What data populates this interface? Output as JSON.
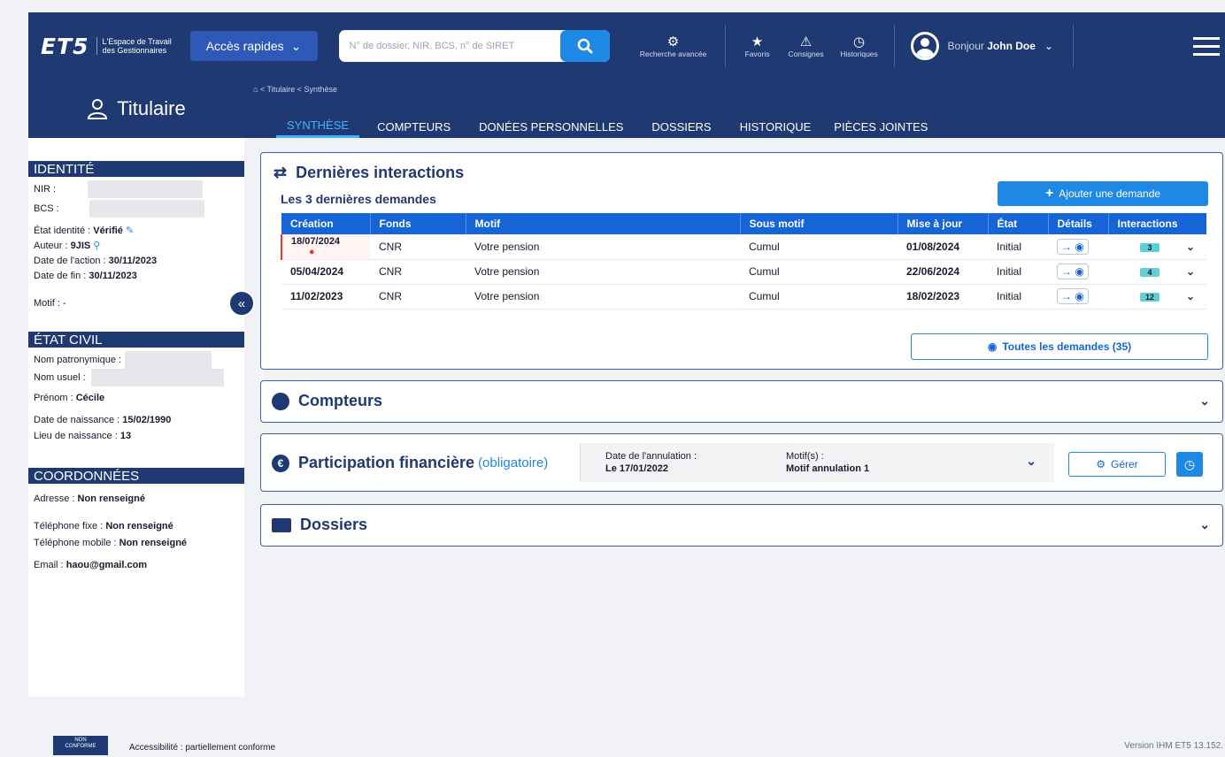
{
  "topbar": {
    "logo": "ET5",
    "logo_sub": "L'Espace de Travail des Gestionnaires",
    "quick_access": "Accès rapides",
    "search_placeholder": "N° de dossier, NIR, BCS, n° de SIRET",
    "advanced_search": "Recherche avancée",
    "favorites": "Favoris",
    "instructions": "Consignes",
    "history": "Historiques",
    "greeting": "Bonjour",
    "user_name": "John Doe"
  },
  "sidebar": {
    "header": "Titulaire",
    "identity": {
      "title": "IDENTITÉ",
      "nir_label": "NIR :",
      "bcs_label": "BCS :",
      "status_label": "État identité :",
      "status_value": "Vérifié",
      "author_label": "Auteur :",
      "author_value": "9JIS",
      "action_date_label": "Date de l'action :",
      "action_date_value": "30/11/2023",
      "end_date_label": "Date de fin :",
      "end_date_value": "30/11/2023",
      "motive_label": "Motif :",
      "motive_value": "-"
    },
    "civil": {
      "title": "ÉTAT CIVIL",
      "birth_name_label": "Nom patronymique :",
      "usual_name_label": "Nom usuel :",
      "first_name_label": "Prénom :",
      "first_name_value": "Cécile",
      "birth_date_label": "Date de naissance :",
      "birth_date_value": "15/02/1990",
      "birth_place_label": "Lieu de naissance :",
      "birth_place_value": "13"
    },
    "contact": {
      "title": "COORDONNÉES",
      "address_label": "Adresse :",
      "address_value": "Non renseigné",
      "landline_label": "Téléphone fixe :",
      "landline_value": "Non renseigné",
      "mobile_label": "Téléphone mobile :",
      "mobile_value": "Non renseigné",
      "email_label": "Email :",
      "email_value": "haou@gmail.com"
    }
  },
  "breadcrumb": "< Titulaire < Synthèse",
  "tabs": [
    "SYNTHÈSE",
    "COMPTEURS",
    "DONÉES PERSONNELLES",
    "DOSSIERS",
    "HISTORIQUE",
    "PIÈCES JOINTES"
  ],
  "interactions": {
    "title": "Dernières interactions",
    "subtitle": "Les 3 dernières demandes",
    "add_button": "Ajouter une demande",
    "columns": [
      "Création",
      "Fonds",
      "Motif",
      "Sous motif",
      "Mise à jour",
      "État",
      "Détails",
      "Interactions"
    ],
    "rows": [
      {
        "creation": "18/07/2024",
        "fonds": "CNR",
        "motif": "Votre pension",
        "sous_motif": "Cumul",
        "maj": "01/08/2024",
        "etat": "Initial",
        "count": "3"
      },
      {
        "creation": "05/04/2024",
        "fonds": "CNR",
        "motif": "Votre pension",
        "sous_motif": "Cumul",
        "maj": "22/06/2024",
        "etat": "Initial",
        "count": "4"
      },
      {
        "creation": "11/02/2023",
        "fonds": "CNR",
        "motif": "Votre pension",
        "sous_motif": "Cumul",
        "maj": "18/02/2023",
        "etat": "Initial",
        "count": "12"
      }
    ],
    "all_button": "Toutes les demandes (35)"
  },
  "counters": {
    "title": "Compteurs"
  },
  "participation": {
    "title": "Participation financière",
    "qualifier": "(obligatoire)",
    "cancel_date_label": "Date de l'annulation :",
    "cancel_date_value": "Le 17/01/2022",
    "motives_label": "Motif(s) :",
    "motives_value": "Motif annulation 1",
    "manage_button": "Gérer"
  },
  "dossiers": {
    "title": "Dossiers"
  },
  "footer": {
    "accessibility": "Accessibilité : partiellement conforme",
    "version": "Version IHM ET5 13.152."
  }
}
